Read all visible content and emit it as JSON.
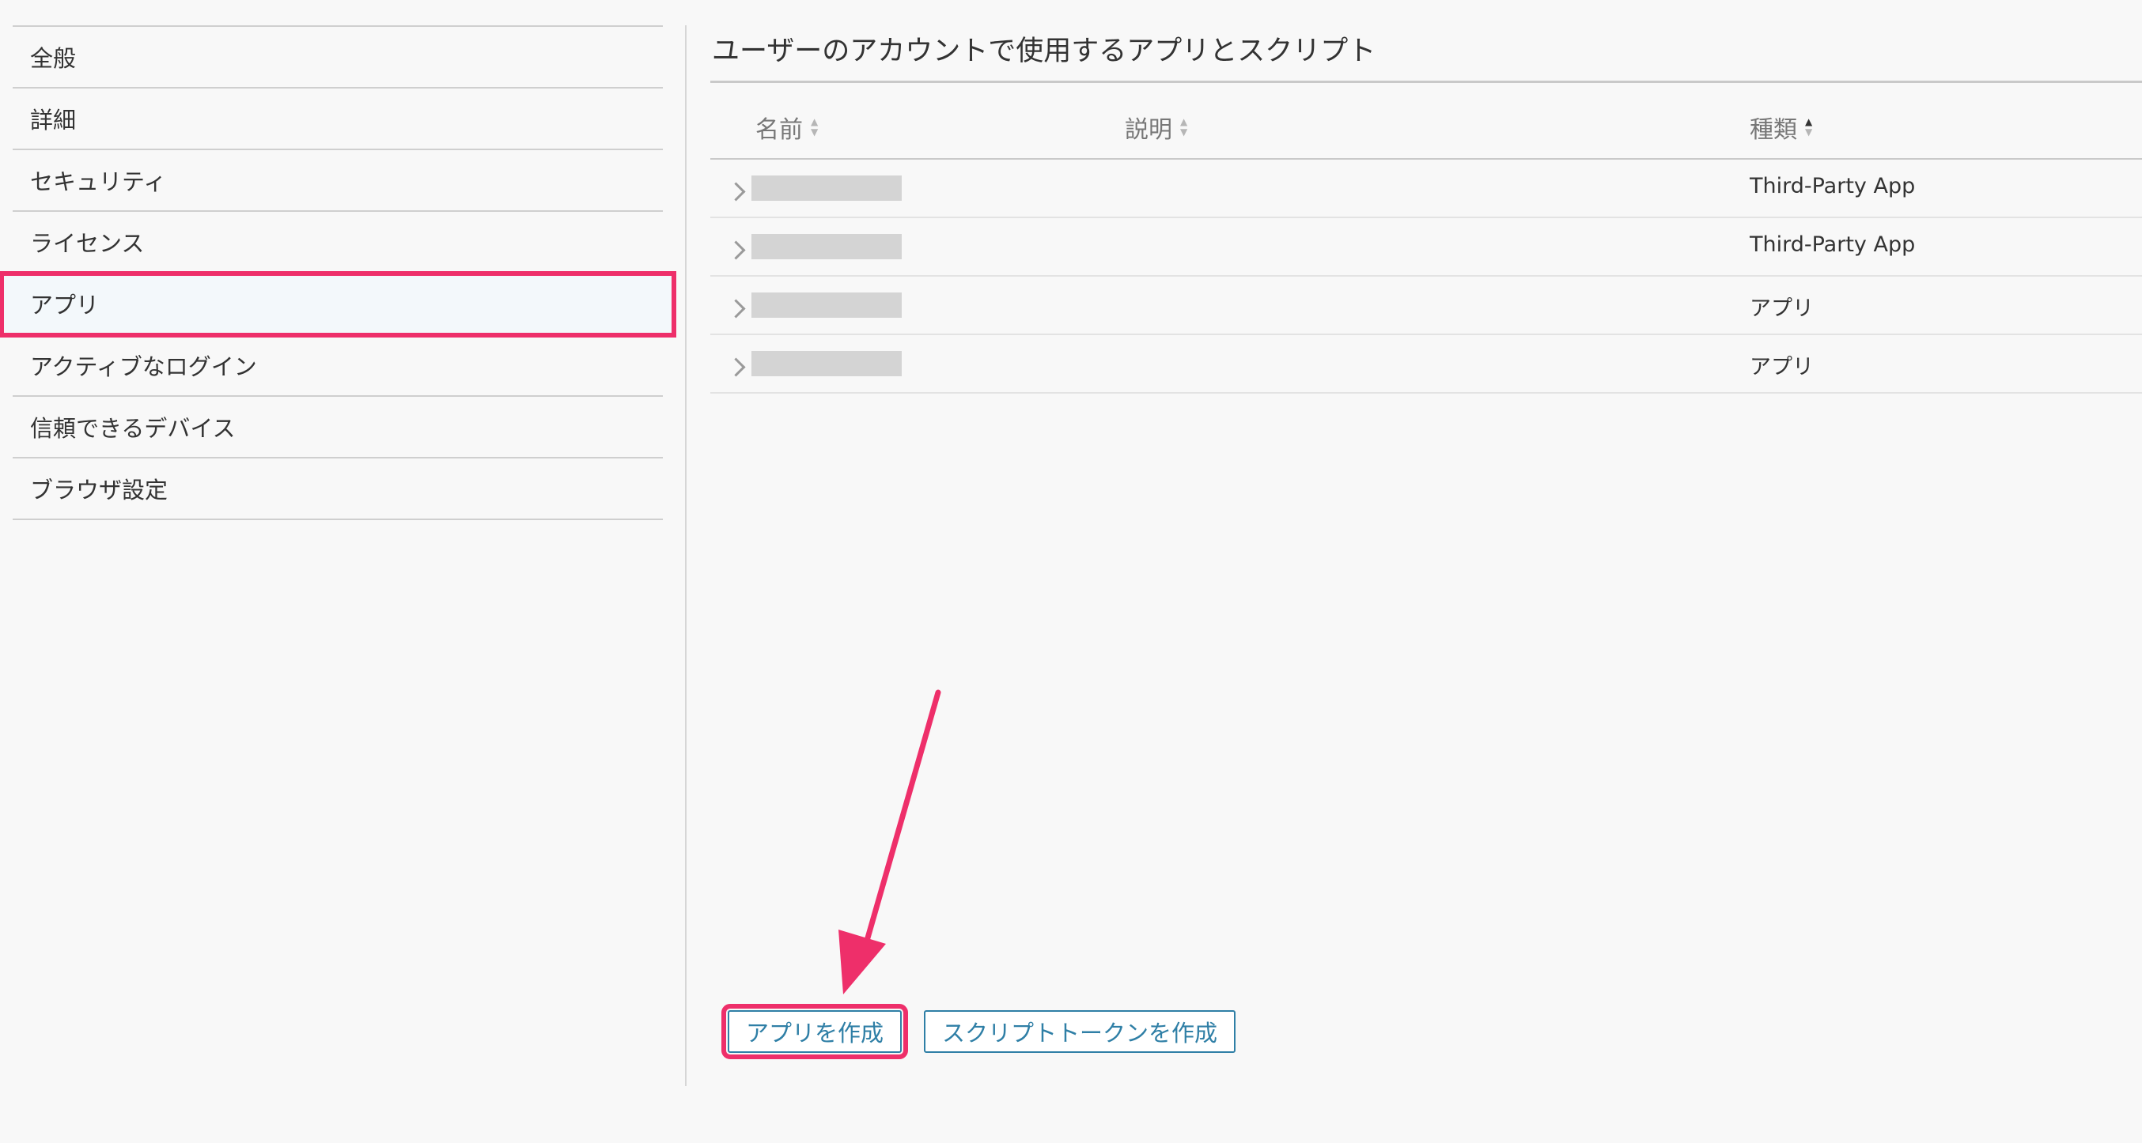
{
  "sidebar": {
    "items": [
      {
        "label": "全般"
      },
      {
        "label": "詳細"
      },
      {
        "label": "セキュリティ"
      },
      {
        "label": "ライセンス"
      },
      {
        "label": "アプリ"
      },
      {
        "label": "アクティブなログイン"
      },
      {
        "label": "信頼できるデバイス"
      },
      {
        "label": "ブラウザ設定"
      }
    ],
    "active_item": "アプリ"
  },
  "main": {
    "title": "ユーザーのアカウントで使用するアプリとスクリプト",
    "table": {
      "columns": [
        {
          "label": "名前",
          "sort": "none"
        },
        {
          "label": "説明",
          "sort": "none"
        },
        {
          "label": "種類",
          "sort": "asc"
        }
      ],
      "rows": [
        {
          "name": "",
          "description": "",
          "type": "Third-Party App"
        },
        {
          "name": "",
          "description": "",
          "type": "Third-Party App"
        },
        {
          "name": "",
          "description": "",
          "type": "アプリ"
        },
        {
          "name": "",
          "description": "",
          "type": "アプリ"
        }
      ]
    },
    "buttons": {
      "create_app": "アプリを作成",
      "create_script_token": "スクリプトトークンを作成"
    }
  },
  "colors": {
    "highlight": "#ee2f6a",
    "button_accent": "#2f7fa6",
    "active_bg": "#f3f8fb"
  },
  "annotation": {
    "icon": "arrow-annotation-icon",
    "target": "create_app"
  }
}
